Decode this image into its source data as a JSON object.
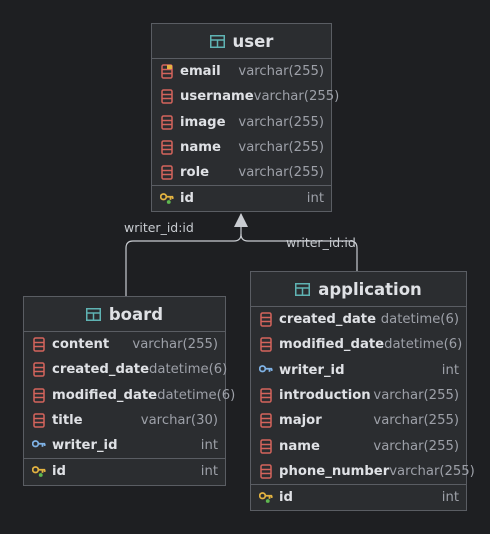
{
  "tables": {
    "user": {
      "name": "user",
      "columns": [
        {
          "name": "email",
          "type": "varchar(255)",
          "icon": "index-column-icon"
        },
        {
          "name": "username",
          "type": "varchar(255)",
          "icon": "column-icon"
        },
        {
          "name": "image",
          "type": "varchar(255)",
          "icon": "column-icon"
        },
        {
          "name": "name",
          "type": "varchar(255)",
          "icon": "column-icon"
        },
        {
          "name": "role",
          "type": "varchar(255)",
          "icon": "column-icon"
        }
      ],
      "pk": {
        "name": "id",
        "type": "int",
        "icon": "primary-key-icon"
      }
    },
    "board": {
      "name": "board",
      "columns": [
        {
          "name": "content",
          "type": "varchar(255)",
          "icon": "column-icon"
        },
        {
          "name": "created_date",
          "type": "datetime(6)",
          "icon": "column-icon"
        },
        {
          "name": "modified_date",
          "type": "datetime(6)",
          "icon": "column-icon"
        },
        {
          "name": "title",
          "type": "varchar(30)",
          "icon": "column-icon"
        },
        {
          "name": "writer_id",
          "type": "int",
          "icon": "foreign-key-icon"
        }
      ],
      "pk": {
        "name": "id",
        "type": "int",
        "icon": "primary-key-icon"
      }
    },
    "application": {
      "name": "application",
      "columns": [
        {
          "name": "created_date",
          "type": "datetime(6)",
          "icon": "column-icon"
        },
        {
          "name": "modified_date",
          "type": "datetime(6)",
          "icon": "column-icon"
        },
        {
          "name": "writer_id",
          "type": "int",
          "icon": "foreign-key-icon"
        },
        {
          "name": "introduction",
          "type": "varchar(255)",
          "icon": "column-icon"
        },
        {
          "name": "major",
          "type": "varchar(255)",
          "icon": "column-icon"
        },
        {
          "name": "name",
          "type": "varchar(255)",
          "icon": "column-icon"
        },
        {
          "name": "phone_number",
          "type": "varchar(255)",
          "icon": "column-icon"
        }
      ],
      "pk": {
        "name": "id",
        "type": "int",
        "icon": "primary-key-icon"
      }
    }
  },
  "relations": [
    {
      "label": "writer_id:id",
      "from": "board",
      "to": "user"
    },
    {
      "label": "writer_id:id",
      "from": "application",
      "to": "user"
    }
  ],
  "colors": {
    "background": "#1e1f22",
    "table_bg": "#2b2d30",
    "column_icon": "#d4645c",
    "table_icon": "#5fb3b3",
    "key_gold": "#e3b341",
    "fk_blue": "#7fb2e5"
  }
}
